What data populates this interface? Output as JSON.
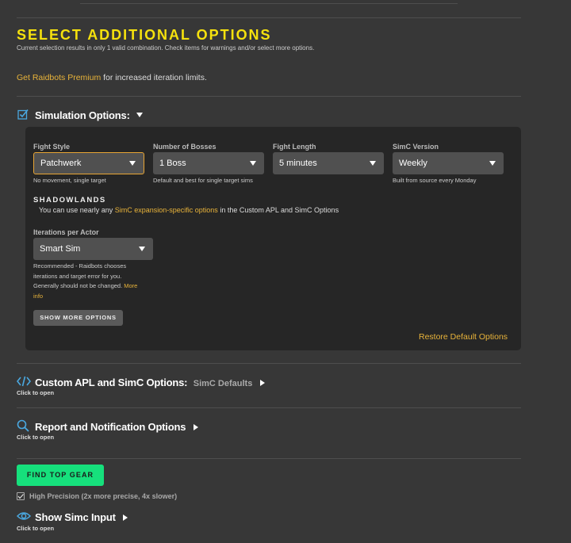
{
  "header": {
    "title": "SELECT ADDITIONAL OPTIONS",
    "subtitle": "Current selection results in only 1 valid combination. Check items for warnings and/or select more options."
  },
  "premium": {
    "link": "Get Raidbots Premium",
    "text": "for increased iteration limits."
  },
  "simulation_options": {
    "title": "Simulation Options:",
    "fields": [
      {
        "label": "Fight Style",
        "value": "Patchwerk",
        "hint": "No movement, single target"
      },
      {
        "label": "Number of Bosses",
        "value": "1 Boss",
        "hint": "Default and best for single target sims"
      },
      {
        "label": "Fight Length",
        "value": "5 minutes",
        "hint": ""
      },
      {
        "label": "SimC Version",
        "value": "Weekly",
        "hint": "Built from source every Monday"
      }
    ],
    "shadowlands": {
      "title": "SHADOWLANDS",
      "text_before": "You can use nearly any",
      "link": "SimC expansion-specific options",
      "text_after": "in the Custom APL and SimC Options"
    },
    "iterations": {
      "label": "Iterations per Actor",
      "value": "Smart Sim",
      "hint_line1": "Recommended - Raidbots chooses",
      "hint_line2": "iterations and target error for you.",
      "hint_line3": "Generally should not be changed.",
      "more_link_1": "More",
      "more_link_2": "info"
    },
    "show_more_label": "SHOW MORE OPTIONS",
    "restore_label": "Restore Default Options"
  },
  "custom_apl": {
    "title": "Custom APL and SimC Options:",
    "status": "SimC Defaults",
    "hint": "Click to open"
  },
  "report": {
    "title": "Report and Notification Options",
    "hint": "Click to open"
  },
  "find_button": "FIND TOP GEAR",
  "high_precision": "High Precision (2x more precise, 4x slower)",
  "simc_input": {
    "title": "Show Simc Input",
    "hint": "Click to open"
  },
  "colors": {
    "accent_yellow": "#f5e10d",
    "link_orange": "#e8b33a",
    "icon_blue": "#4aa8e0",
    "find_green": "#16e07c"
  }
}
